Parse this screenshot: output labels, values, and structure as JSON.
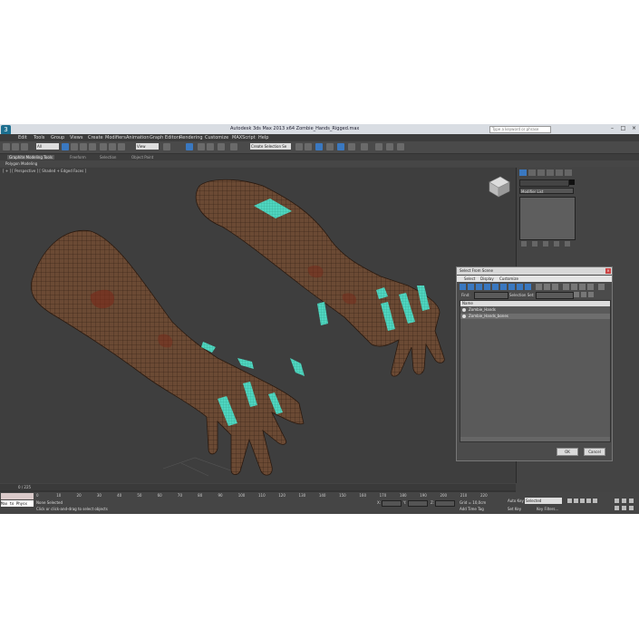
{
  "window": {
    "title": "Autodesk 3ds Max 2013 x64    Zombie_Hands_Rigged.max",
    "search_placeholder": "Type a keyword or phrase"
  },
  "menu": [
    "Edit",
    "Tools",
    "Group",
    "Views",
    "Create",
    "Modifiers",
    "Animation",
    "Graph Editors",
    "Rendering",
    "Customize",
    "MAXScript",
    "Help"
  ],
  "toolbar": {
    "selection_filter": "All",
    "reference_coord": "View",
    "named_selection": "Create Selection Se"
  },
  "ribbon": {
    "tabs": [
      "Graphite Modeling Tools",
      "Freeform",
      "Selection",
      "Object Paint"
    ],
    "sub": "Polygon Modeling"
  },
  "viewport": {
    "label": "[ + ] [ Perspective ] [ Shaded + Edged Faces ]"
  },
  "command_panel": {
    "modifier_list": "Modifier List"
  },
  "dialog": {
    "title": "Select From Scene",
    "menu": [
      "Select",
      "Display",
      "Customize"
    ],
    "find_label": "Find:",
    "selection_set_label": "Selection Set:",
    "column_header": "Name",
    "items": [
      "Zombie_Hands",
      "Zombie_Hands_bones"
    ],
    "ok": "OK",
    "cancel": "Cancel"
  },
  "timeline": {
    "frame_readout": "0 / 225",
    "ticks": [
      "0",
      "10",
      "20",
      "30",
      "40",
      "50",
      "60",
      "70",
      "80",
      "90",
      "100",
      "110",
      "120",
      "130",
      "140",
      "150",
      "160",
      "170",
      "180",
      "190",
      "200",
      "210",
      "220"
    ]
  },
  "status": {
    "script_listener": "Max to Physx",
    "selected_text": "None Selected",
    "prompt": "Click or click-and-drag to select objects",
    "grid": "Grid = 10,0cm",
    "add_time_tag": "Add Time Tag",
    "auto_key": "Auto Key",
    "auto_key_value": "Selected",
    "set_key": "Set Key",
    "key_filters": "Key Filters...",
    "x_label": "X:",
    "y_label": "Y:",
    "z_label": "Z:"
  },
  "colors": {
    "accent": "#3a78c0",
    "skin": "#6b4a34",
    "bone_highlight": "#4fd6c0"
  }
}
